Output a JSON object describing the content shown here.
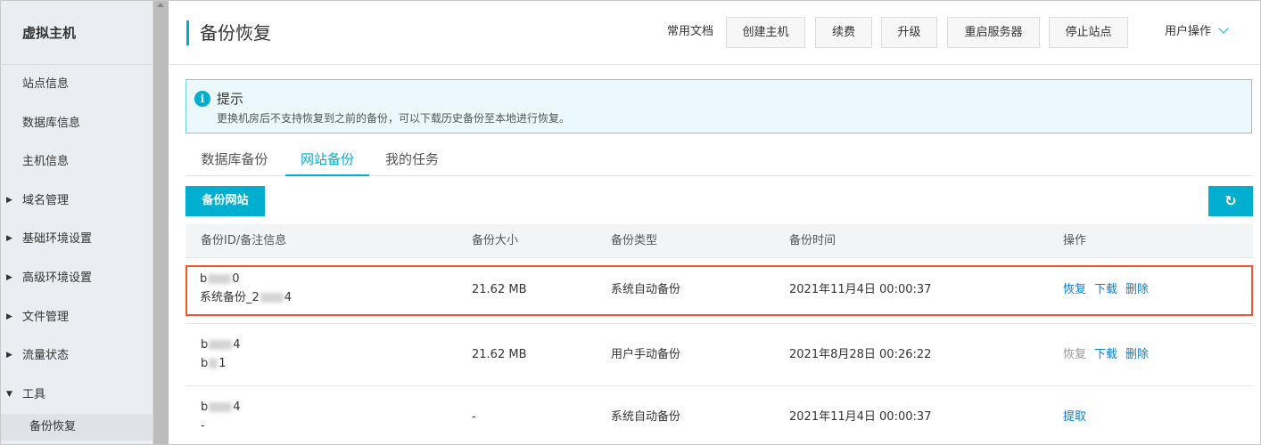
{
  "sidebar": {
    "title": "虚拟主机",
    "items": [
      {
        "label": "站点信息"
      },
      {
        "label": "数据库信息"
      },
      {
        "label": "主机信息"
      },
      {
        "label": "域名管理"
      },
      {
        "label": "基础环境设置"
      },
      {
        "label": "高级环境设置"
      },
      {
        "label": "文件管理"
      },
      {
        "label": "流量状态"
      },
      {
        "label": "工具"
      }
    ],
    "subitem": "备份恢复"
  },
  "header": {
    "title": "备份恢复",
    "doc_link": "常用文档",
    "buttons": {
      "create": "创建主机",
      "renew": "续费",
      "upgrade": "升级",
      "restart": "重启服务器",
      "stop": "停止站点"
    },
    "user_ops": "用户操作"
  },
  "notice": {
    "title": "提示",
    "text": "更换机房后不支持恢复到之前的备份，可以下载历史备份至本地进行恢复。"
  },
  "tabs": {
    "db": "数据库备份",
    "site": "网站备份",
    "tasks": "我的任务"
  },
  "actions": {
    "backup_site": "备份网站",
    "refresh_glyph": "↻"
  },
  "table": {
    "headers": {
      "id": "备份ID/备注信息",
      "size": "备份大小",
      "type": "备份类型",
      "time": "备份时间",
      "ops": "操作"
    },
    "rows": [
      {
        "id_prefix": "b",
        "id_suffix": "0",
        "note_prefix": "系统备份_2",
        "note_suffix": "4",
        "size": "21.62 MB",
        "type": "系统自动备份",
        "time": "2021年11月4日 00:00:37",
        "restore": "恢复",
        "download": "下载",
        "delete": "删除"
      },
      {
        "id_prefix": "b",
        "id_suffix": "4",
        "note_prefix": "b",
        "note_suffix": "1",
        "size": "21.62 MB",
        "type": "用户手动备份",
        "time": "2021年8月28日 00:26:22",
        "restore": "恢复",
        "download": "下载",
        "delete": "删除"
      },
      {
        "id_prefix": "b",
        "id_suffix": "4",
        "note_prefix": "-",
        "note_suffix": "",
        "size": "-",
        "type": "系统自动备份",
        "time": "2021年11月4日 00:00:37",
        "fetch": "提取"
      }
    ]
  },
  "colors": {
    "accent": "#00aecf",
    "link": "#0a7ec7",
    "highlight": "#ee5a2a"
  }
}
